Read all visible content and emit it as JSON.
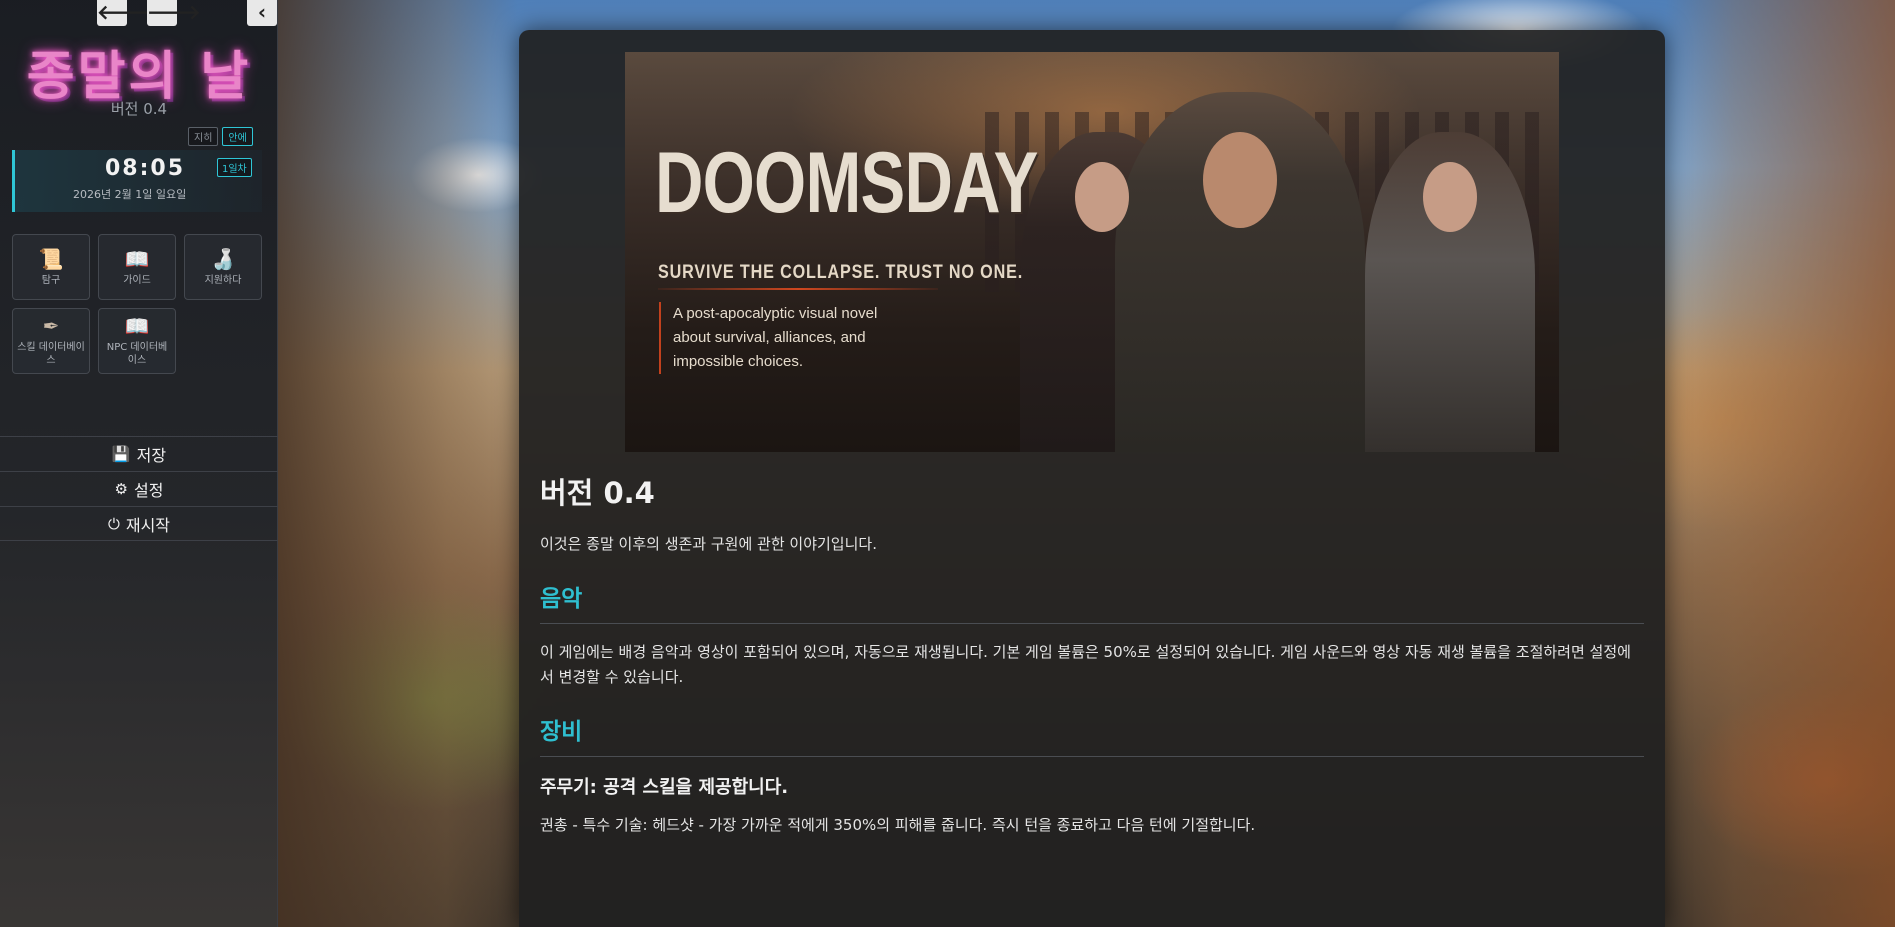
{
  "sidebar": {
    "nav": {
      "back_icon": "🡐",
      "forward_icon": "🡒",
      "collapse_icon": "‹"
    },
    "title": "종말의 날",
    "version": "버전 0.4",
    "toggles": [
      {
        "label": "지히"
      },
      {
        "label": "안에"
      }
    ],
    "clock": {
      "time": "08:05",
      "date": "2026년 2월 1일 일요일",
      "day": "1일차"
    },
    "menu": [
      {
        "label": "탐구",
        "icon": "scroll-icon"
      },
      {
        "label": "가이드",
        "icon": "book-icon"
      },
      {
        "label": "지원하다",
        "icon": "bottle-icon"
      },
      {
        "label": "스킬 데이터베이스",
        "icon": "quill-icon"
      },
      {
        "label": "NPC 데이터베이스",
        "icon": "book-icon"
      }
    ],
    "actions": [
      {
        "label": "저장",
        "icon": "save-icon"
      },
      {
        "label": "설정",
        "icon": "gear-icon"
      },
      {
        "label": "재시작",
        "icon": "power-icon"
      }
    ]
  },
  "banner": {
    "title": "DOOMSDAY",
    "tagline": "SURVIVE THE COLLAPSE. TRUST NO ONE.",
    "description": "A post-apocalyptic visual novel about survival, alliances, and impossible choices."
  },
  "content": {
    "heading": "버전 0.4",
    "intro": "이것은 종말 이후의 생존과 구원에 관한 이야기입니다.",
    "music_heading": "음악",
    "music_text": "이 게임에는 배경 음악과 영상이 포함되어 있으며, 자동으로 재생됩니다. 기본 게임 볼륨은 50%로 설정되어 있습니다. 게임 사운드와 영상 자동 재생 볼륨을 조절하려면 설정에서 변경할 수 있습니다.",
    "equipment_heading": "장비",
    "equipment_subheading": "주무기: 공격 스킬을 제공합니다.",
    "equipment_text": "권총 - 특수 기술: 헤드샷 - 가장 가까운 적에게 350%의 피해를 줍니다. 즉시 턴을 종료하고 다음 턴에 기절합니다."
  },
  "colors": {
    "accent": "#2fc6d6",
    "title_pink": "#e985c8",
    "panel_bg": "#202020"
  }
}
